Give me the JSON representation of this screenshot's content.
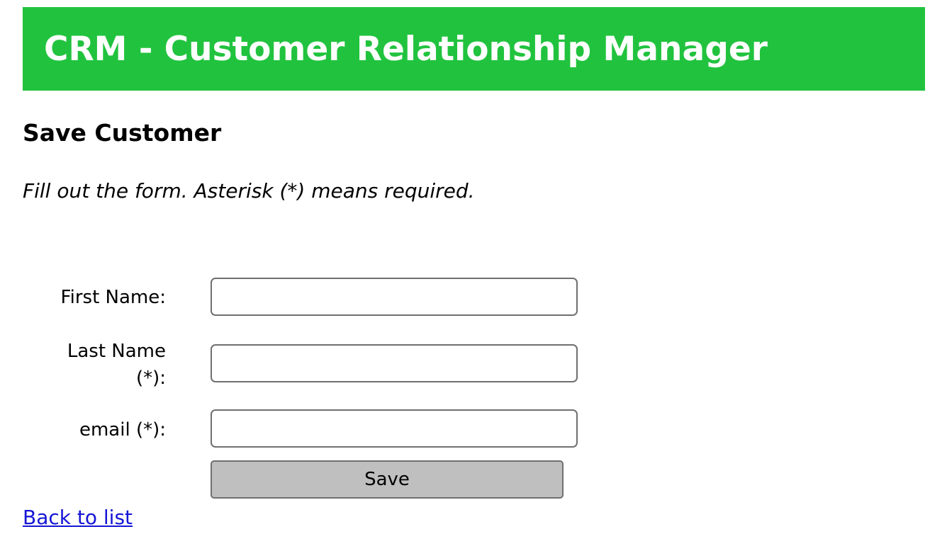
{
  "header": {
    "app_title": "CRM - Customer Relationship Manager",
    "background_color": "#21c33e",
    "text_color": "#ffffff"
  },
  "main": {
    "page_title": "Save Customer",
    "instructions": "Fill out the form. Asterisk (*) means required."
  },
  "form": {
    "fields": [
      {
        "label_line1": "First Name:",
        "label_line2": "",
        "value": "",
        "placeholder": ""
      },
      {
        "label_line1": "Last Name",
        "label_line2": "(*):",
        "value": "",
        "placeholder": ""
      },
      {
        "label_line1": "email (*):",
        "label_line2": "",
        "value": "",
        "placeholder": ""
      }
    ],
    "save_label": "Save",
    "save_button_color": "#bfbfbf"
  },
  "footer": {
    "back_link_label": "Back to list",
    "link_color": "#1515d6"
  }
}
